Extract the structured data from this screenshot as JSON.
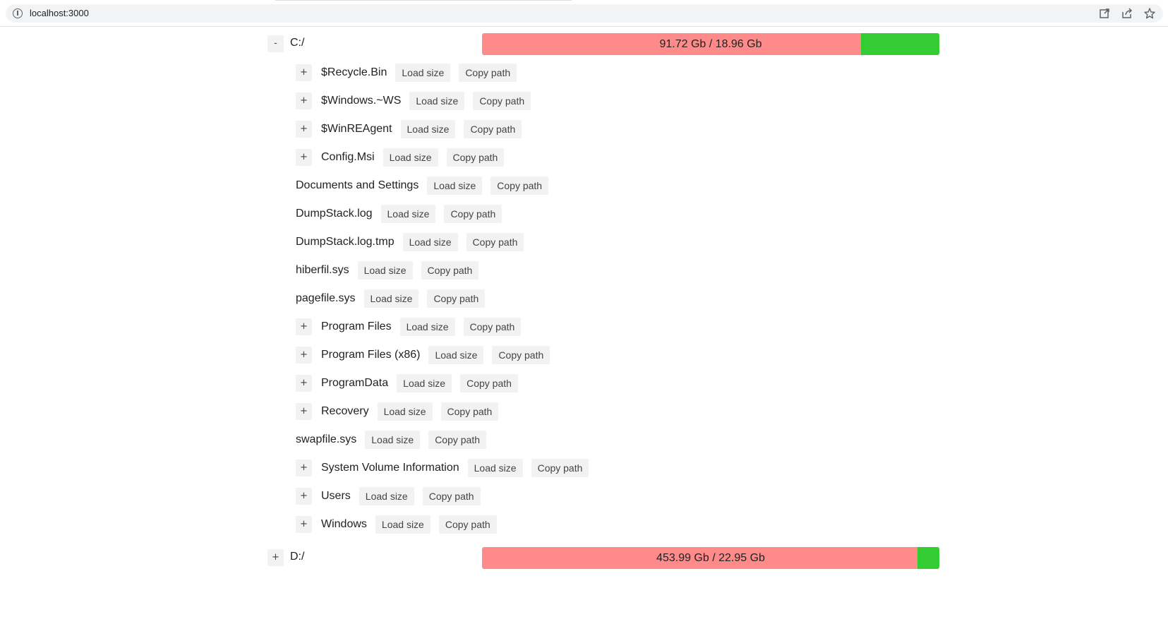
{
  "browser": {
    "url": "localhost:3000"
  },
  "drives": [
    {
      "label": "C:/",
      "toggle": "-",
      "usage_text": "91.72 Gb / 18.96 Gb",
      "used_fraction": 0.829,
      "colors": {
        "used": "#ff8a8a",
        "free": "#33cc33"
      }
    },
    {
      "label": "D:/",
      "toggle": "+",
      "usage_text": "453.99 Gb / 22.95 Gb",
      "used_fraction": 0.952,
      "colors": {
        "used": "#ff8a8a",
        "free": "#33cc33"
      }
    }
  ],
  "entries": [
    {
      "name": "$Recycle.Bin",
      "has_toggle": true,
      "toggle": "+",
      "load_label": "Load size",
      "copy_label": "Copy path"
    },
    {
      "name": "$Windows.~WS",
      "has_toggle": true,
      "toggle": "+",
      "load_label": "Load size",
      "copy_label": "Copy path"
    },
    {
      "name": "$WinREAgent",
      "has_toggle": true,
      "toggle": "+",
      "load_label": "Load size",
      "copy_label": "Copy path"
    },
    {
      "name": "Config.Msi",
      "has_toggle": true,
      "toggle": "+",
      "load_label": "Load size",
      "copy_label": "Copy path"
    },
    {
      "name": "Documents and Settings",
      "has_toggle": false,
      "toggle": "",
      "load_label": "Load size",
      "copy_label": "Copy path"
    },
    {
      "name": "DumpStack.log",
      "has_toggle": false,
      "toggle": "",
      "load_label": "Load size",
      "copy_label": "Copy path"
    },
    {
      "name": "DumpStack.log.tmp",
      "has_toggle": false,
      "toggle": "",
      "load_label": "Load size",
      "copy_label": "Copy path"
    },
    {
      "name": "hiberfil.sys",
      "has_toggle": false,
      "toggle": "",
      "load_label": "Load size",
      "copy_label": "Copy path"
    },
    {
      "name": "pagefile.sys",
      "has_toggle": false,
      "toggle": "",
      "load_label": "Load size",
      "copy_label": "Copy path"
    },
    {
      "name": "Program Files",
      "has_toggle": true,
      "toggle": "+",
      "load_label": "Load size",
      "copy_label": "Copy path"
    },
    {
      "name": "Program Files (x86)",
      "has_toggle": true,
      "toggle": "+",
      "load_label": "Load size",
      "copy_label": "Copy path"
    },
    {
      "name": "ProgramData",
      "has_toggle": true,
      "toggle": "+",
      "load_label": "Load size",
      "copy_label": "Copy path"
    },
    {
      "name": "Recovery",
      "has_toggle": true,
      "toggle": "+",
      "load_label": "Load size",
      "copy_label": "Copy path"
    },
    {
      "name": "swapfile.sys",
      "has_toggle": false,
      "toggle": "",
      "load_label": "Load size",
      "copy_label": "Copy path"
    },
    {
      "name": "System Volume Information",
      "has_toggle": true,
      "toggle": "+",
      "load_label": "Load size",
      "copy_label": "Copy path"
    },
    {
      "name": "Users",
      "has_toggle": true,
      "toggle": "+",
      "load_label": "Load size",
      "copy_label": "Copy path"
    },
    {
      "name": "Windows",
      "has_toggle": true,
      "toggle": "+",
      "load_label": "Load size",
      "copy_label": "Copy path"
    }
  ]
}
